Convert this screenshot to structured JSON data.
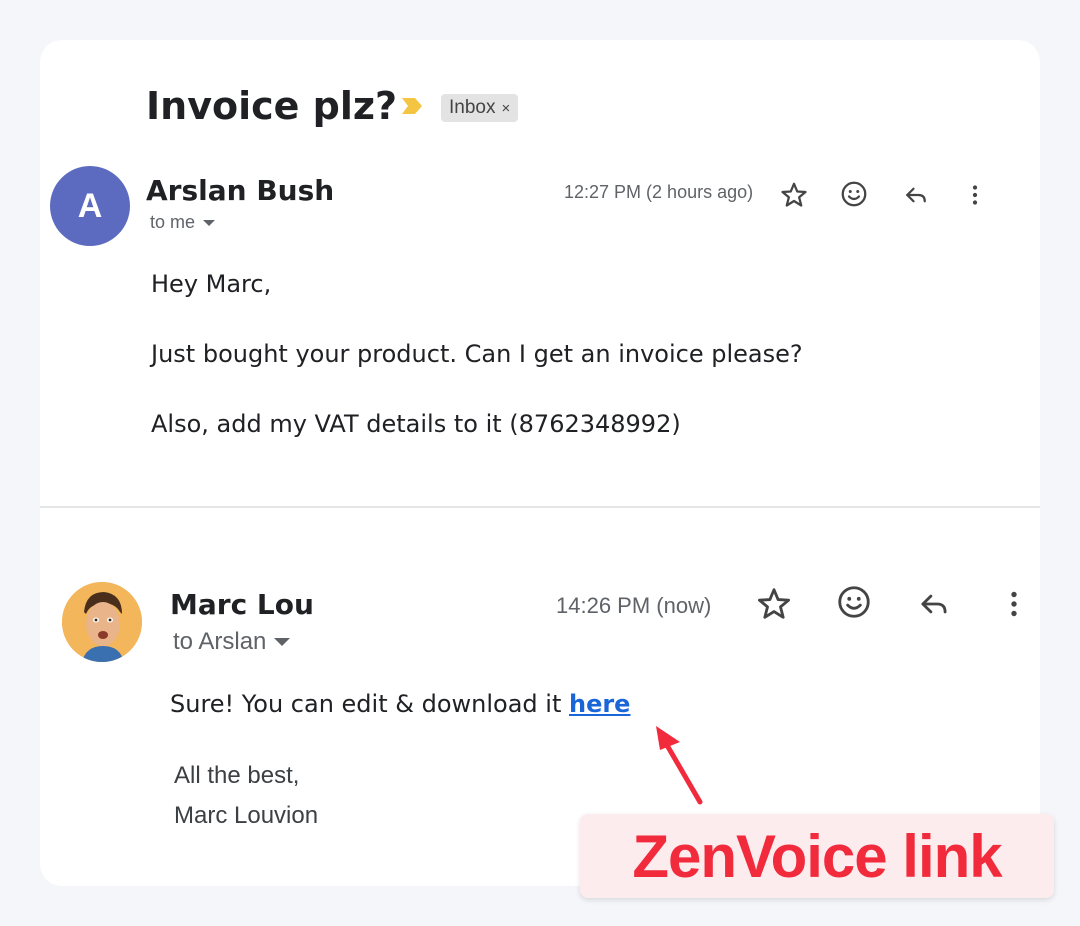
{
  "thread": {
    "subject": "Invoice plz?",
    "label": "Inbox",
    "label_close": "×"
  },
  "messages": [
    {
      "sender": "Arslan Bush",
      "avatar_letter": "A",
      "recipient": "to me",
      "time": "12:27 PM (2 hours ago)",
      "body": [
        "Hey Marc,",
        "Just bought your product. Can I get an invoice please?",
        "Also, add my VAT details to it (8762348992)"
      ]
    },
    {
      "sender": "Marc Lou",
      "recipient": "to Arslan",
      "time": "14:26 PM (now)",
      "body_prefix": "Sure! You can edit & download it ",
      "link_text": "here",
      "signature": [
        "All the best,",
        "Marc Louvion"
      ]
    }
  ],
  "annotation": {
    "text": "ZenVoice link"
  },
  "colors": {
    "avatar_a": "#5c6bc0",
    "avatar_photo_bg": "#f3b65a",
    "link": "#1a66d9",
    "callout_text": "#f12a3c",
    "callout_bg": "#fdecee",
    "importance": "#f4c542"
  },
  "icons": [
    "importance-marker-icon",
    "star-icon",
    "emoji-icon",
    "reply-icon",
    "more-vert-icon",
    "chevron-down-icon"
  ]
}
